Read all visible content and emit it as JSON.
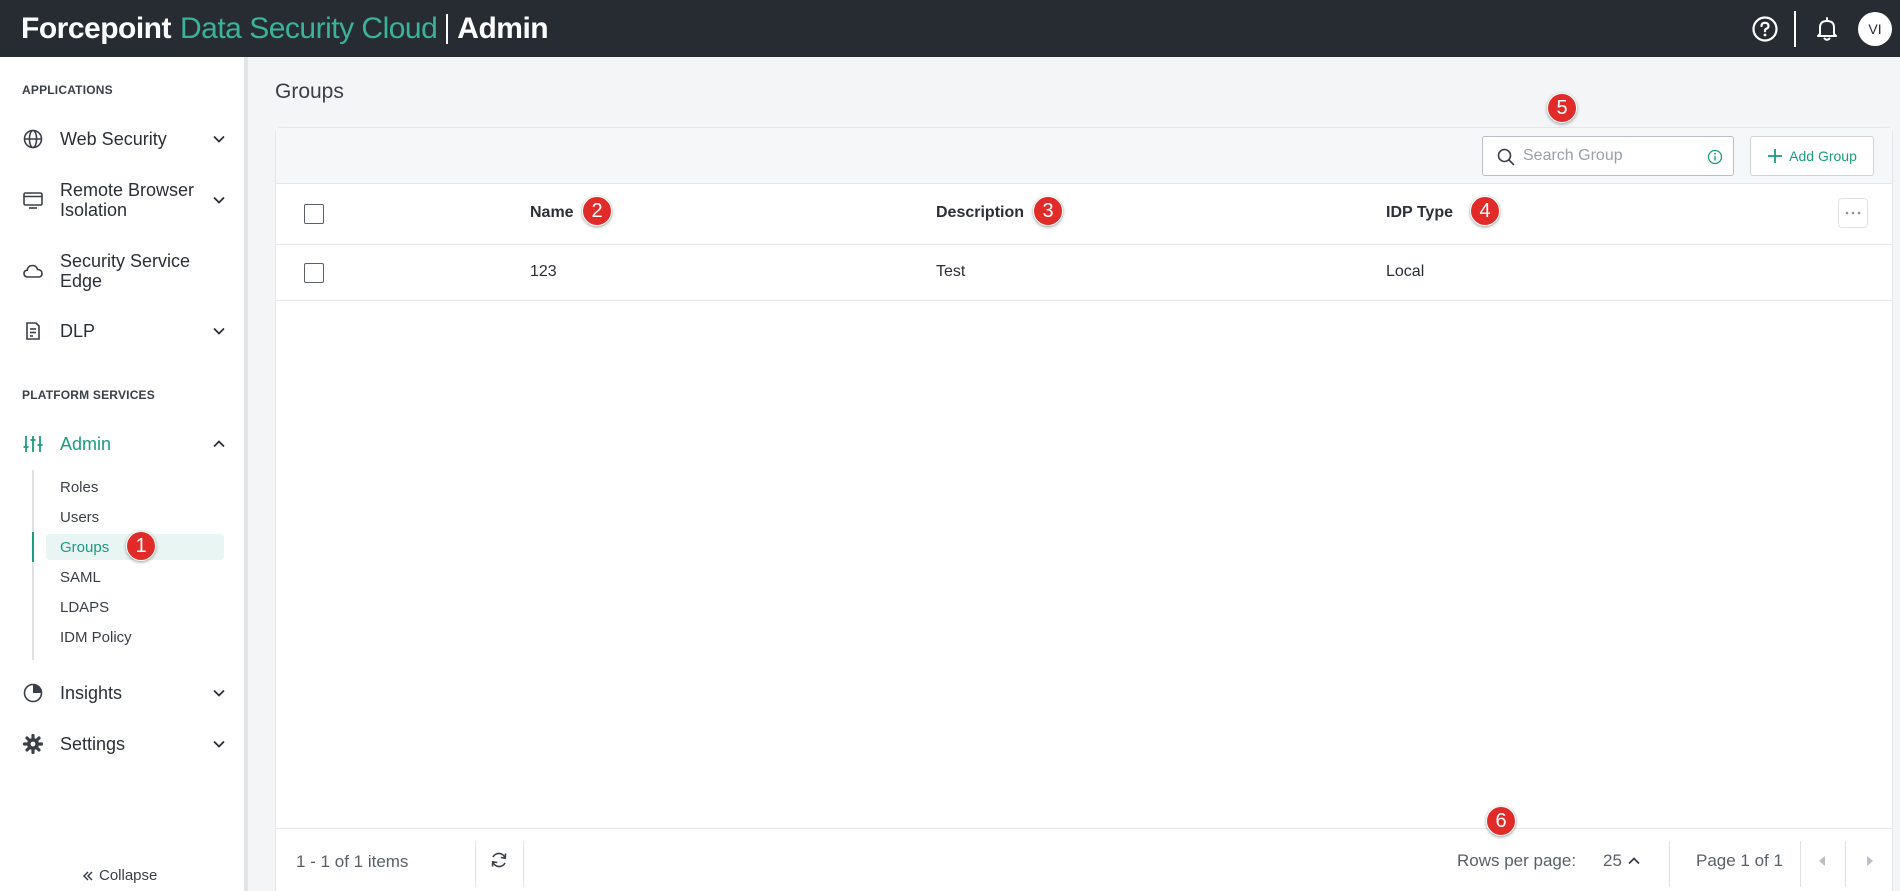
{
  "header": {
    "brand_main": "Forcepoint",
    "brand_accent": "Data Security Cloud",
    "brand_section": "Admin",
    "avatar_initials": "VI",
    "icons": [
      "help-icon",
      "bell-icon"
    ]
  },
  "sidebar": {
    "section_applications": "APPLICATIONS",
    "section_platform": "PLATFORM SERVICES",
    "items": [
      {
        "label": "Web Security",
        "icon": "globe-icon"
      },
      {
        "label": "Remote Browser\nIsolation",
        "icon": "browser-icon"
      },
      {
        "label": "Security Service\nEdge",
        "icon": "cloud-icon"
      },
      {
        "label": "DLP",
        "icon": "document-icon"
      },
      {
        "label": "Admin",
        "icon": "sliders-icon"
      },
      {
        "label": "Insights",
        "icon": "pie-chart-icon"
      },
      {
        "label": "Settings",
        "icon": "gear-icon"
      }
    ],
    "admin_sub": [
      "Roles",
      "Users",
      "Groups",
      "SAML",
      "LDAPS",
      "IDM Policy"
    ],
    "collapse_label": "Collapse"
  },
  "main": {
    "page_title": "Groups",
    "search_placeholder": "Search Group",
    "add_button": "Add Group",
    "columns": [
      "Name",
      "Description",
      "IDP Type"
    ],
    "rows": [
      {
        "name": "123",
        "description": "Test",
        "idp_type": "Local"
      }
    ],
    "footer": {
      "items_count": "1 - 1 of 1 items",
      "rows_per_page_label": "Rows per page:",
      "rows_per_page_value": "25",
      "page_info": "Page 1 of 1"
    }
  },
  "callouts": [
    "1",
    "2",
    "3",
    "4",
    "5",
    "6"
  ],
  "colors": {
    "header_bg": "#272c33",
    "accent": "#1a9b82",
    "brand_accent": "#3ab39a",
    "badge": "#e02b28"
  }
}
